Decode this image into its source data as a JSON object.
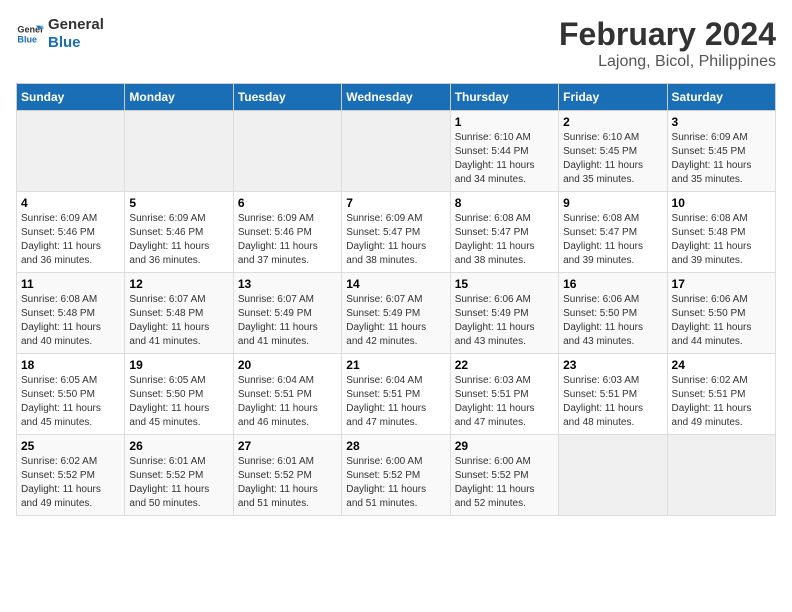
{
  "logo": {
    "line1": "General",
    "line2": "Blue"
  },
  "title": "February 2024",
  "subtitle": "Lajong, Bicol, Philippines",
  "headers": [
    "Sunday",
    "Monday",
    "Tuesday",
    "Wednesday",
    "Thursday",
    "Friday",
    "Saturday"
  ],
  "weeks": [
    [
      {
        "day": "",
        "info": ""
      },
      {
        "day": "",
        "info": ""
      },
      {
        "day": "",
        "info": ""
      },
      {
        "day": "",
        "info": ""
      },
      {
        "day": "1",
        "info": "Sunrise: 6:10 AM\nSunset: 5:44 PM\nDaylight: 11 hours\nand 34 minutes."
      },
      {
        "day": "2",
        "info": "Sunrise: 6:10 AM\nSunset: 5:45 PM\nDaylight: 11 hours\nand 35 minutes."
      },
      {
        "day": "3",
        "info": "Sunrise: 6:09 AM\nSunset: 5:45 PM\nDaylight: 11 hours\nand 35 minutes."
      }
    ],
    [
      {
        "day": "4",
        "info": "Sunrise: 6:09 AM\nSunset: 5:46 PM\nDaylight: 11 hours\nand 36 minutes."
      },
      {
        "day": "5",
        "info": "Sunrise: 6:09 AM\nSunset: 5:46 PM\nDaylight: 11 hours\nand 36 minutes."
      },
      {
        "day": "6",
        "info": "Sunrise: 6:09 AM\nSunset: 5:46 PM\nDaylight: 11 hours\nand 37 minutes."
      },
      {
        "day": "7",
        "info": "Sunrise: 6:09 AM\nSunset: 5:47 PM\nDaylight: 11 hours\nand 38 minutes."
      },
      {
        "day": "8",
        "info": "Sunrise: 6:08 AM\nSunset: 5:47 PM\nDaylight: 11 hours\nand 38 minutes."
      },
      {
        "day": "9",
        "info": "Sunrise: 6:08 AM\nSunset: 5:47 PM\nDaylight: 11 hours\nand 39 minutes."
      },
      {
        "day": "10",
        "info": "Sunrise: 6:08 AM\nSunset: 5:48 PM\nDaylight: 11 hours\nand 39 minutes."
      }
    ],
    [
      {
        "day": "11",
        "info": "Sunrise: 6:08 AM\nSunset: 5:48 PM\nDaylight: 11 hours\nand 40 minutes."
      },
      {
        "day": "12",
        "info": "Sunrise: 6:07 AM\nSunset: 5:48 PM\nDaylight: 11 hours\nand 41 minutes."
      },
      {
        "day": "13",
        "info": "Sunrise: 6:07 AM\nSunset: 5:49 PM\nDaylight: 11 hours\nand 41 minutes."
      },
      {
        "day": "14",
        "info": "Sunrise: 6:07 AM\nSunset: 5:49 PM\nDaylight: 11 hours\nand 42 minutes."
      },
      {
        "day": "15",
        "info": "Sunrise: 6:06 AM\nSunset: 5:49 PM\nDaylight: 11 hours\nand 43 minutes."
      },
      {
        "day": "16",
        "info": "Sunrise: 6:06 AM\nSunset: 5:50 PM\nDaylight: 11 hours\nand 43 minutes."
      },
      {
        "day": "17",
        "info": "Sunrise: 6:06 AM\nSunset: 5:50 PM\nDaylight: 11 hours\nand 44 minutes."
      }
    ],
    [
      {
        "day": "18",
        "info": "Sunrise: 6:05 AM\nSunset: 5:50 PM\nDaylight: 11 hours\nand 45 minutes."
      },
      {
        "day": "19",
        "info": "Sunrise: 6:05 AM\nSunset: 5:50 PM\nDaylight: 11 hours\nand 45 minutes."
      },
      {
        "day": "20",
        "info": "Sunrise: 6:04 AM\nSunset: 5:51 PM\nDaylight: 11 hours\nand 46 minutes."
      },
      {
        "day": "21",
        "info": "Sunrise: 6:04 AM\nSunset: 5:51 PM\nDaylight: 11 hours\nand 47 minutes."
      },
      {
        "day": "22",
        "info": "Sunrise: 6:03 AM\nSunset: 5:51 PM\nDaylight: 11 hours\nand 47 minutes."
      },
      {
        "day": "23",
        "info": "Sunrise: 6:03 AM\nSunset: 5:51 PM\nDaylight: 11 hours\nand 48 minutes."
      },
      {
        "day": "24",
        "info": "Sunrise: 6:02 AM\nSunset: 5:51 PM\nDaylight: 11 hours\nand 49 minutes."
      }
    ],
    [
      {
        "day": "25",
        "info": "Sunrise: 6:02 AM\nSunset: 5:52 PM\nDaylight: 11 hours\nand 49 minutes."
      },
      {
        "day": "26",
        "info": "Sunrise: 6:01 AM\nSunset: 5:52 PM\nDaylight: 11 hours\nand 50 minutes."
      },
      {
        "day": "27",
        "info": "Sunrise: 6:01 AM\nSunset: 5:52 PM\nDaylight: 11 hours\nand 51 minutes."
      },
      {
        "day": "28",
        "info": "Sunrise: 6:00 AM\nSunset: 5:52 PM\nDaylight: 11 hours\nand 51 minutes."
      },
      {
        "day": "29",
        "info": "Sunrise: 6:00 AM\nSunset: 5:52 PM\nDaylight: 11 hours\nand 52 minutes."
      },
      {
        "day": "",
        "info": ""
      },
      {
        "day": "",
        "info": ""
      }
    ]
  ]
}
